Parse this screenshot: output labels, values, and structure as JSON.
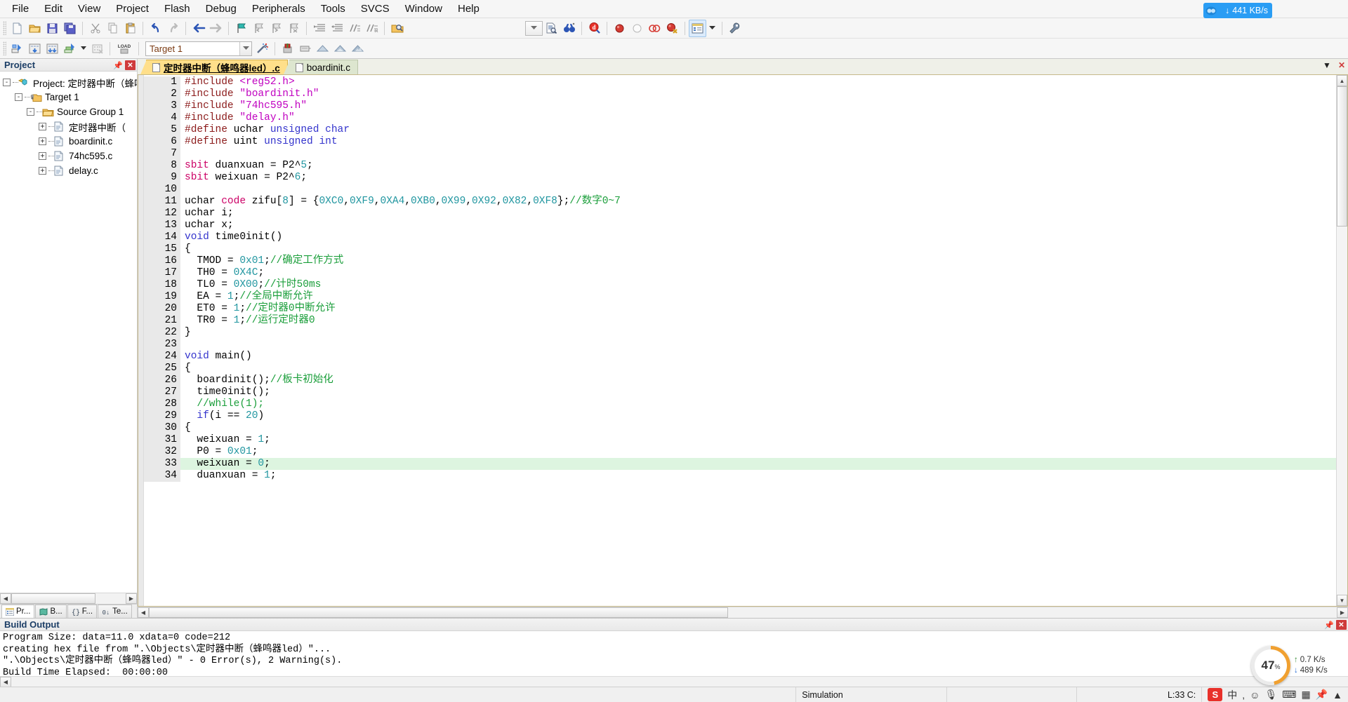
{
  "menubar": {
    "items": [
      "File",
      "Edit",
      "View",
      "Project",
      "Flash",
      "Debug",
      "Peripherals",
      "Tools",
      "SVCS",
      "Window",
      "Help"
    ]
  },
  "toolbar1": {
    "buttons": [
      {
        "name": "new-file",
        "icon": "new-document-icon"
      },
      {
        "name": "open-file",
        "icon": "open-folder-icon"
      },
      {
        "name": "save-file",
        "icon": "save-disk-icon"
      },
      {
        "name": "save-all",
        "icon": "save-all-icon"
      },
      {
        "name": "cut",
        "icon": "scissors-icon"
      },
      {
        "name": "copy",
        "icon": "copy-icon"
      },
      {
        "name": "paste",
        "icon": "paste-icon"
      },
      {
        "name": "undo",
        "icon": "undo-arrow-icon"
      },
      {
        "name": "redo",
        "icon": "redo-arrow-icon"
      },
      {
        "name": "navigate-back",
        "icon": "arrow-left-icon"
      },
      {
        "name": "navigate-forward",
        "icon": "arrow-right-icon"
      },
      {
        "name": "insert-bookmark",
        "icon": "bookmark-flag-icon"
      },
      {
        "name": "prev-bookmark",
        "icon": "bookmark-prev-icon"
      },
      {
        "name": "next-bookmark",
        "icon": "bookmark-next-icon"
      },
      {
        "name": "clear-bookmarks",
        "icon": "bookmark-clear-icon"
      },
      {
        "name": "indent-right",
        "icon": "indent-right-icon"
      },
      {
        "name": "indent-left",
        "icon": "indent-left-icon"
      },
      {
        "name": "comment-lines",
        "icon": "comment-icon"
      },
      {
        "name": "uncomment-lines",
        "icon": "uncomment-icon"
      },
      {
        "name": "find-in-files",
        "icon": "find-files-icon"
      },
      {
        "name": "find-combo",
        "icon": "chevron-down-icon"
      },
      {
        "name": "find-in-doc",
        "icon": "find-document-icon"
      },
      {
        "name": "bookmark-tool",
        "icon": "binoculars-icon"
      },
      {
        "name": "start-debug",
        "icon": "debug-magnifier-icon"
      },
      {
        "name": "insert-breakpoint",
        "icon": "breakpoint-red-icon"
      },
      {
        "name": "kill-breakpoint",
        "icon": "breakpoint-empty-icon"
      },
      {
        "name": "disable-breakpoint",
        "icon": "breakpoint-disable-icon"
      },
      {
        "name": "kill-all-breakpoints",
        "icon": "breakpoint-killall-icon"
      },
      {
        "name": "project-window-toggle",
        "icon": "project-window-icon",
        "active": true
      },
      {
        "name": "project-window-dropdown",
        "icon": "chevron-down-icon"
      },
      {
        "name": "configuration-wizard",
        "icon": "wrench-icon"
      }
    ]
  },
  "toolbar2": {
    "buttons": [
      {
        "name": "translate-file",
        "icon": "translate-icon"
      },
      {
        "name": "build-target",
        "icon": "build-icon"
      },
      {
        "name": "rebuild-all",
        "icon": "rebuild-all-icon"
      },
      {
        "name": "batch-build",
        "icon": "batch-build-icon"
      },
      {
        "name": "batch-build-dropdown",
        "icon": "chevron-down-icon"
      },
      {
        "name": "stop-build",
        "icon": "stop-build-icon"
      },
      {
        "name": "download",
        "icon": "load-icon"
      },
      {
        "name": "target-options",
        "icon": "target-options-icon"
      },
      {
        "name": "manage-components",
        "icon": "manage-wand-icon"
      },
      {
        "name": "pack-installer",
        "icon": "pack-installer-icon"
      },
      {
        "name": "manage-run-time",
        "icon": "manage-runtime-icon"
      },
      {
        "name": "select-sw-packs-1",
        "icon": "pack-select-1-icon"
      },
      {
        "name": "select-sw-packs-2",
        "icon": "pack-select-2-icon"
      },
      {
        "name": "select-sw-packs-3",
        "icon": "pack-select-3-icon"
      }
    ],
    "target_value": "Target 1"
  },
  "project_panel": {
    "title": "Project",
    "tree": [
      {
        "label": "Project: 定时器中断（蜂鸣",
        "depth": 0,
        "expander": "-",
        "icon": "project-icon"
      },
      {
        "label": "Target 1",
        "depth": 1,
        "expander": "-",
        "icon": "target-folder-icon"
      },
      {
        "label": "Source Group 1",
        "depth": 2,
        "expander": "-",
        "icon": "folder-icon"
      },
      {
        "label": "定时器中断（",
        "depth": 3,
        "expander": "+",
        "icon": "c-file-icon"
      },
      {
        "label": "boardinit.c",
        "depth": 3,
        "expander": "+",
        "icon": "c-file-icon"
      },
      {
        "label": "74hc595.c",
        "depth": 3,
        "expander": "+",
        "icon": "c-file-icon"
      },
      {
        "label": "delay.c",
        "depth": 3,
        "expander": "+",
        "icon": "c-file-icon"
      }
    ],
    "bottom_tabs": [
      {
        "label": "Pr...",
        "icon": "project-tab-icon",
        "selected": true
      },
      {
        "label": "B...",
        "icon": "books-tab-icon",
        "selected": false
      },
      {
        "label": "F...",
        "icon": "functions-tab-icon",
        "selected": false
      },
      {
        "label": "Te...",
        "icon": "templates-tab-icon",
        "selected": false
      }
    ]
  },
  "editor": {
    "tabs": [
      {
        "label": "定时器中断（蜂鸣器led）.c",
        "active": true
      },
      {
        "label": "boardinit.c",
        "active": false
      }
    ],
    "window_buttons": [
      {
        "name": "restore-window-button",
        "glyph": "▼"
      },
      {
        "name": "close-window-button",
        "glyph": "✕"
      }
    ],
    "lines": [
      {
        "n": 1,
        "tokens": [
          [
            "k-pre",
            "#include"
          ],
          [
            "k-plain",
            " "
          ],
          [
            "k-str",
            "<reg52.h>"
          ]
        ]
      },
      {
        "n": 2,
        "tokens": [
          [
            "k-pre",
            "#include"
          ],
          [
            "k-plain",
            " "
          ],
          [
            "k-str",
            "\"boardinit.h\""
          ]
        ]
      },
      {
        "n": 3,
        "tokens": [
          [
            "k-pre",
            "#include"
          ],
          [
            "k-plain",
            " "
          ],
          [
            "k-str",
            "\"74hc595.h\""
          ]
        ]
      },
      {
        "n": 4,
        "tokens": [
          [
            "k-pre",
            "#include"
          ],
          [
            "k-plain",
            " "
          ],
          [
            "k-str",
            "\"delay.h\""
          ]
        ]
      },
      {
        "n": 5,
        "tokens": [
          [
            "k-pre",
            "#define"
          ],
          [
            "k-plain",
            " uchar "
          ],
          [
            "k-kw",
            "unsigned char"
          ]
        ]
      },
      {
        "n": 6,
        "tokens": [
          [
            "k-pre",
            "#define"
          ],
          [
            "k-plain",
            " uint "
          ],
          [
            "k-kw",
            "unsigned int"
          ]
        ]
      },
      {
        "n": 7,
        "tokens": []
      },
      {
        "n": 8,
        "tokens": [
          [
            "k-kw2",
            "sbit"
          ],
          [
            "k-plain",
            " duanxuan = P2^"
          ],
          [
            "k-num",
            "5"
          ],
          [
            "k-plain",
            ";"
          ]
        ]
      },
      {
        "n": 9,
        "tokens": [
          [
            "k-kw2",
            "sbit"
          ],
          [
            "k-plain",
            " weixuan = P2^"
          ],
          [
            "k-num",
            "6"
          ],
          [
            "k-plain",
            ";"
          ]
        ]
      },
      {
        "n": 10,
        "tokens": []
      },
      {
        "n": 11,
        "tokens": [
          [
            "k-plain",
            "uchar "
          ],
          [
            "k-kw2",
            "code"
          ],
          [
            "k-plain",
            " zifu["
          ],
          [
            "k-num",
            "8"
          ],
          [
            "k-plain",
            "] = {"
          ],
          [
            "k-num",
            "0XC0"
          ],
          [
            "k-plain",
            ","
          ],
          [
            "k-num",
            "0XF9"
          ],
          [
            "k-plain",
            ","
          ],
          [
            "k-num",
            "0XA4"
          ],
          [
            "k-plain",
            ","
          ],
          [
            "k-num",
            "0XB0"
          ],
          [
            "k-plain",
            ","
          ],
          [
            "k-num",
            "0X99"
          ],
          [
            "k-plain",
            ","
          ],
          [
            "k-num",
            "0X92"
          ],
          [
            "k-plain",
            ","
          ],
          [
            "k-num",
            "0X82"
          ],
          [
            "k-plain",
            ","
          ],
          [
            "k-num",
            "0XF8"
          ],
          [
            "k-plain",
            "};"
          ],
          [
            "k-com",
            "//数字0~7"
          ]
        ]
      },
      {
        "n": 12,
        "tokens": [
          [
            "k-plain",
            "uchar i;"
          ]
        ]
      },
      {
        "n": 13,
        "tokens": [
          [
            "k-plain",
            "uchar x;"
          ]
        ]
      },
      {
        "n": 14,
        "tokens": [
          [
            "k-kw",
            "void"
          ],
          [
            "k-plain",
            " time0init()"
          ]
        ]
      },
      {
        "n": 15,
        "tokens": [
          [
            "k-plain",
            "{"
          ]
        ]
      },
      {
        "n": 16,
        "tokens": [
          [
            "k-plain",
            "  TMOD = "
          ],
          [
            "k-num",
            "0x01"
          ],
          [
            "k-plain",
            ";"
          ],
          [
            "k-com",
            "//确定工作方式"
          ]
        ]
      },
      {
        "n": 17,
        "tokens": [
          [
            "k-plain",
            "  TH0 = "
          ],
          [
            "k-num",
            "0X4C"
          ],
          [
            "k-plain",
            ";"
          ]
        ]
      },
      {
        "n": 18,
        "tokens": [
          [
            "k-plain",
            "  TL0 = "
          ],
          [
            "k-num",
            "0X00"
          ],
          [
            "k-plain",
            ";"
          ],
          [
            "k-com",
            "//计时50ms"
          ]
        ]
      },
      {
        "n": 19,
        "tokens": [
          [
            "k-plain",
            "  EA = "
          ],
          [
            "k-num",
            "1"
          ],
          [
            "k-plain",
            ";"
          ],
          [
            "k-com",
            "//全局中断允许"
          ]
        ]
      },
      {
        "n": 20,
        "tokens": [
          [
            "k-plain",
            "  ET0 = "
          ],
          [
            "k-num",
            "1"
          ],
          [
            "k-plain",
            ";"
          ],
          [
            "k-com",
            "//定时器0中断允许"
          ]
        ]
      },
      {
        "n": 21,
        "tokens": [
          [
            "k-plain",
            "  TR0 = "
          ],
          [
            "k-num",
            "1"
          ],
          [
            "k-plain",
            ";"
          ],
          [
            "k-com",
            "//运行定时器0"
          ]
        ]
      },
      {
        "n": 22,
        "tokens": [
          [
            "k-plain",
            "}"
          ]
        ]
      },
      {
        "n": 23,
        "tokens": []
      },
      {
        "n": 24,
        "tokens": [
          [
            "k-kw",
            "void"
          ],
          [
            "k-plain",
            " main()"
          ]
        ]
      },
      {
        "n": 25,
        "tokens": [
          [
            "k-plain",
            "{"
          ]
        ]
      },
      {
        "n": 26,
        "tokens": [
          [
            "k-plain",
            "  boardinit();"
          ],
          [
            "k-com",
            "//板卡初始化"
          ]
        ]
      },
      {
        "n": 27,
        "tokens": [
          [
            "k-plain",
            "  time0init();"
          ]
        ]
      },
      {
        "n": 28,
        "tokens": [
          [
            "k-com",
            "  //while(1);"
          ]
        ]
      },
      {
        "n": 29,
        "tokens": [
          [
            "k-plain",
            "  "
          ],
          [
            "k-kw",
            "if"
          ],
          [
            "k-plain",
            "(i == "
          ],
          [
            "k-num",
            "20"
          ],
          [
            "k-plain",
            ")"
          ]
        ]
      },
      {
        "n": 30,
        "tokens": [
          [
            "k-plain",
            "{"
          ]
        ]
      },
      {
        "n": 31,
        "tokens": [
          [
            "k-plain",
            "  weixuan = "
          ],
          [
            "k-num",
            "1"
          ],
          [
            "k-plain",
            ";"
          ]
        ]
      },
      {
        "n": 32,
        "tokens": [
          [
            "k-plain",
            "  P0 = "
          ],
          [
            "k-num",
            "0x01"
          ],
          [
            "k-plain",
            ";"
          ]
        ]
      },
      {
        "n": 33,
        "tokens": [
          [
            "k-plain",
            "  weixuan = "
          ],
          [
            "k-num",
            "0"
          ],
          [
            "k-plain",
            ";"
          ]
        ],
        "highlight": true
      },
      {
        "n": 34,
        "tokens": [
          [
            "k-plain",
            "  duanxuan = "
          ],
          [
            "k-num",
            "1"
          ],
          [
            "k-plain",
            ";"
          ]
        ]
      }
    ]
  },
  "build_output": {
    "title": "Build Output",
    "lines": [
      "Program Size: data=11.0 xdata=0 code=212",
      "creating hex file from \".\\Objects\\定时器中断（蜂鸣器led）\"...",
      "\".\\Objects\\定时器中断（蜂鸣器led）\" - 0 Error(s), 2 Warning(s).",
      "Build Time Elapsed:  00:00:00"
    ]
  },
  "statusbar": {
    "simulation": "Simulation",
    "position": "L:33 C:",
    "tray": [
      "ime-s-icon",
      "中",
      "·",
      "smiley-icon",
      "microphone-icon",
      "keyboard-icon",
      "panel-icon",
      "pin-icon",
      "caret-icon"
    ]
  },
  "overlays": {
    "network_badge": {
      "speed": "441 KB/s",
      "icon": "cloud-globe-icon",
      "arrow": "↓",
      "color": "#2a9df4"
    },
    "speed_widget": {
      "percent": "47",
      "percent_symbol": "%",
      "up": "0.7 K/s",
      "down": "489 K/s",
      "up_arrow": "↑",
      "down_arrow": "↓"
    }
  }
}
